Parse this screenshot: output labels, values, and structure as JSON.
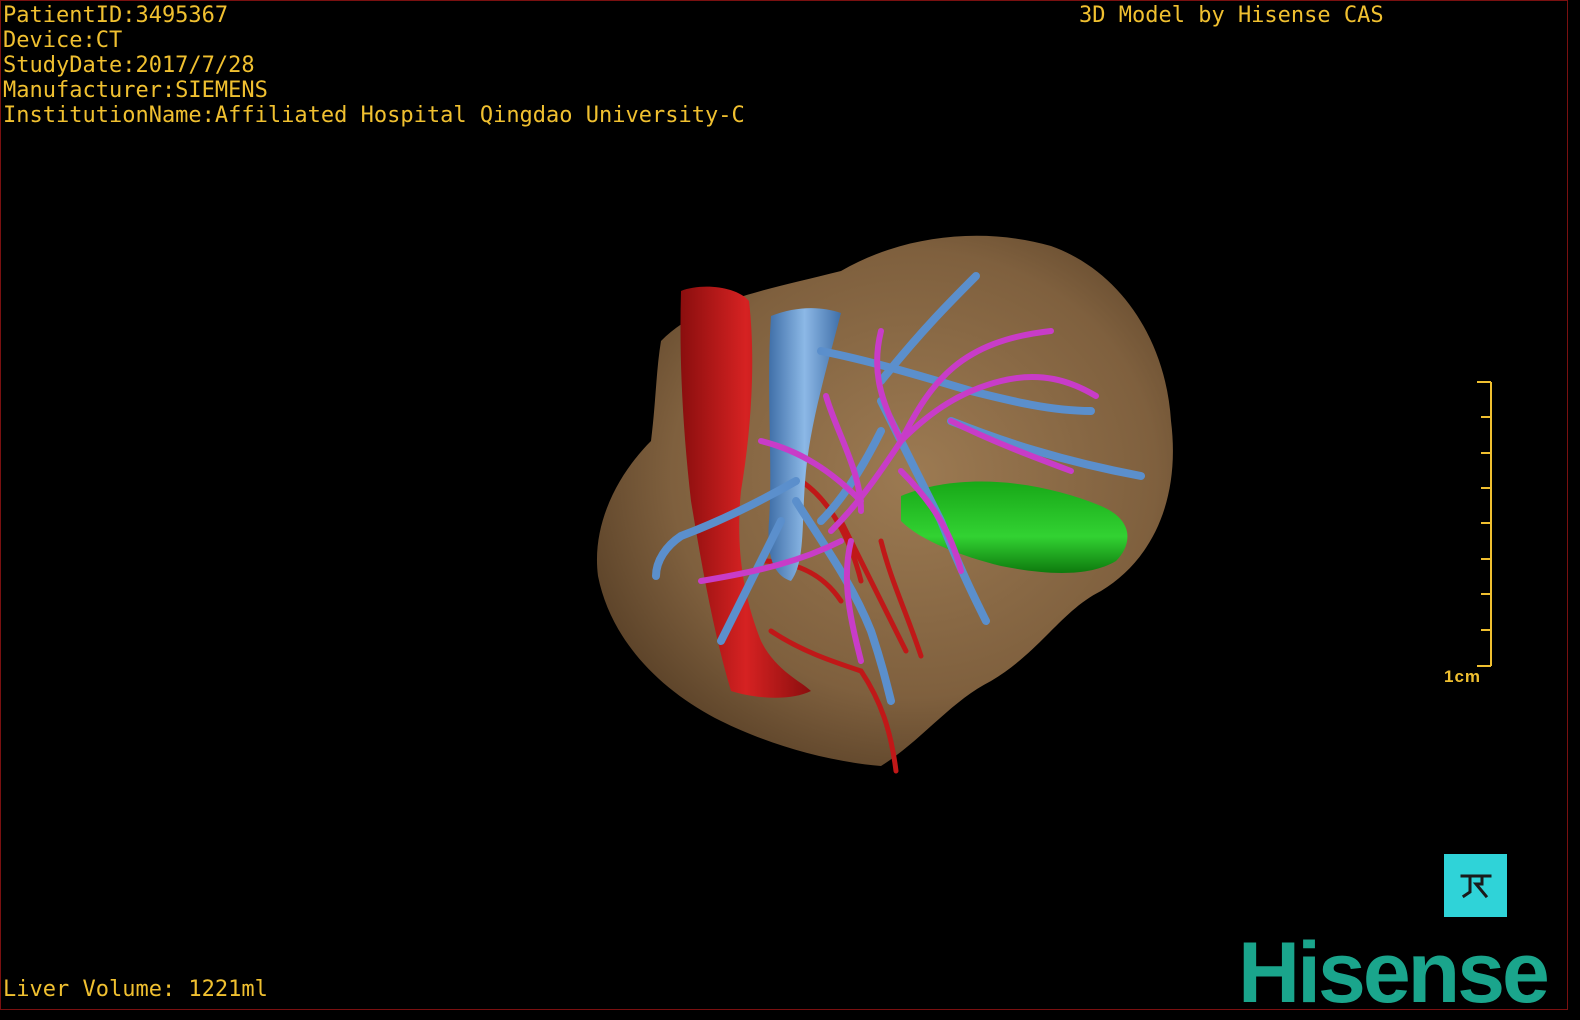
{
  "header": {
    "patient_line": "PatientID:3495367",
    "device_line": "Device:CT",
    "study_date_line": "StudyDate:2017/7/28",
    "manufacturer_line": "Manufacturer:SIEMENS",
    "institution_line": "InstitutionName:Affiliated Hospital Qingdao University-C"
  },
  "credit": "3D Model by Hisense CAS",
  "footer": {
    "volume_line": "Liver Volume: 1221ml"
  },
  "scale": {
    "label": "1cm"
  },
  "brand": "Hisense",
  "icons": {
    "reset_view": "reset-view-icon"
  },
  "colors": {
    "overlay_text": "#f0c030",
    "liver": "#8c6a45",
    "artery": "#c01818",
    "hepatic_vein": "#5b8fcc",
    "portal_vein": "#c83cc8",
    "tumor": "#1ea01e",
    "button_bg": "#2fd3d8",
    "brand": "#1aa58c"
  }
}
